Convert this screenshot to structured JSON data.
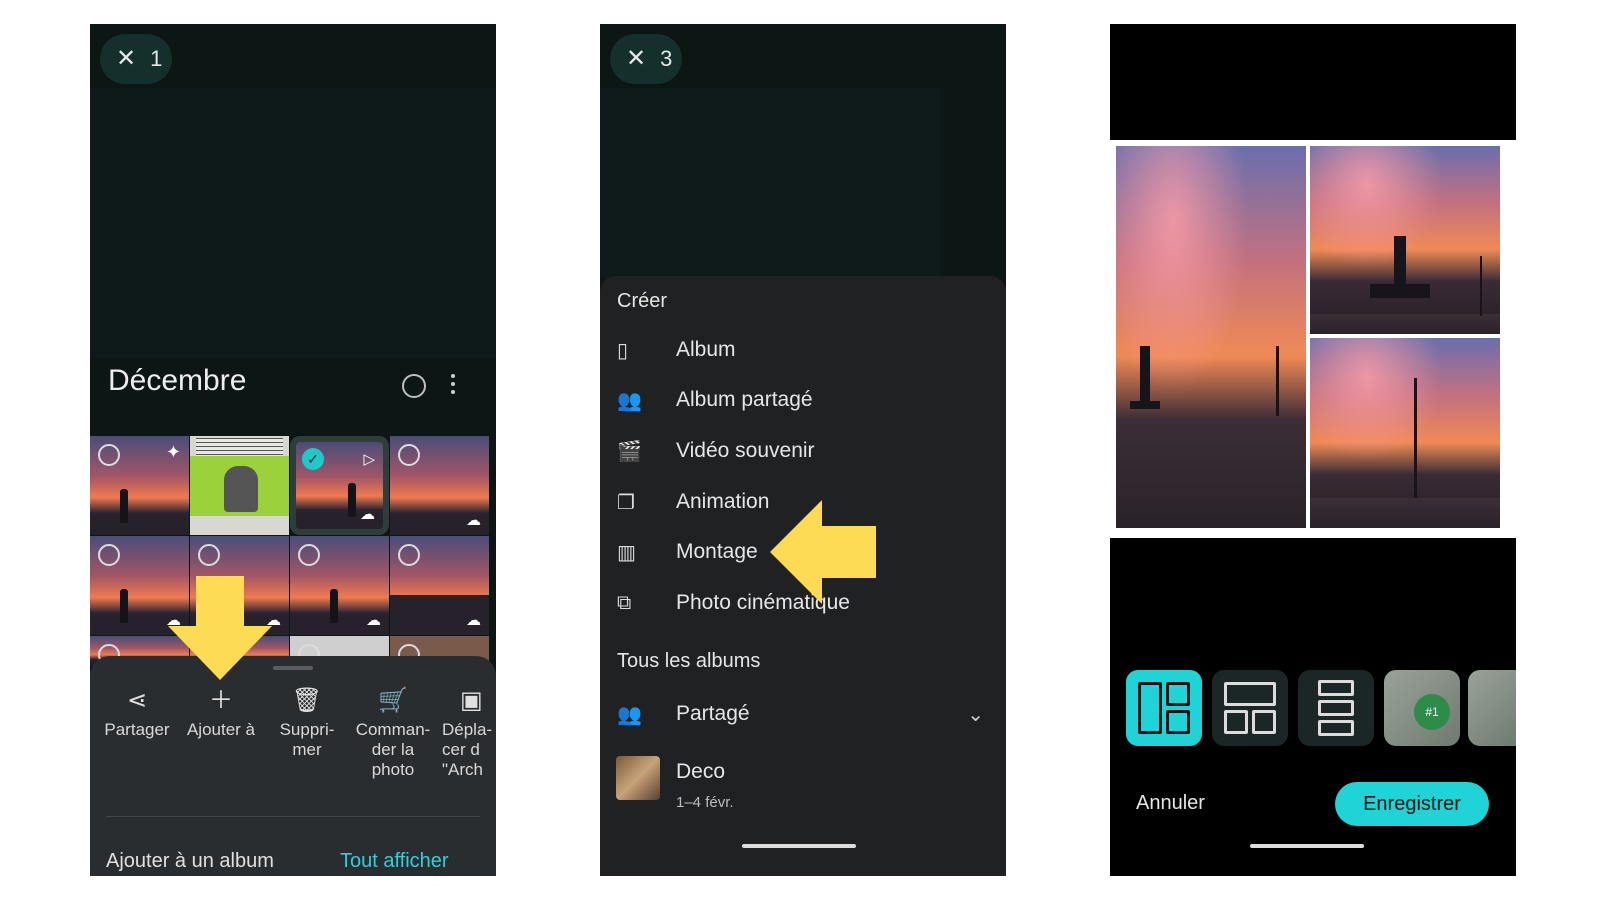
{
  "panel1": {
    "selection_count": "1",
    "month": "Décembre",
    "actions": [
      {
        "label": "Partager",
        "icon": "share-icon"
      },
      {
        "label": "Ajouter à",
        "icon": "plus-icon"
      },
      {
        "label": "Suppri-\nmer",
        "icon": "trash-icon"
      },
      {
        "label": "Comman-\nder la\nphoto",
        "icon": "cart-icon"
      },
      {
        "label": "Dépla-\ncer d\n\"Arch",
        "icon": "archive-icon"
      }
    ],
    "add_to_album": "Ajouter à un album",
    "see_all": "Tout afficher"
  },
  "panel2": {
    "selection_count": "3",
    "create_title": "Créer",
    "create_items": [
      {
        "label": "Album",
        "icon": "album-icon"
      },
      {
        "label": "Album partagé",
        "icon": "shared-album-icon"
      },
      {
        "label": "Vidéo souvenir",
        "icon": "clapperboard-icon"
      },
      {
        "label": "Animation",
        "icon": "animation-icon"
      },
      {
        "label": "Montage",
        "icon": "collage-icon"
      },
      {
        "label": "Photo cinématique",
        "icon": "cinematic-icon"
      }
    ],
    "all_albums_title": "Tous les albums",
    "shared": "Partagé",
    "album": {
      "name": "Deco",
      "date": "1–4 févr."
    }
  },
  "panel3": {
    "cancel": "Annuler",
    "save": "Enregistrer"
  },
  "colors": {
    "accent": "#1fd3d6",
    "arrow": "#fddb55",
    "dark_bg": "#0c1615"
  }
}
